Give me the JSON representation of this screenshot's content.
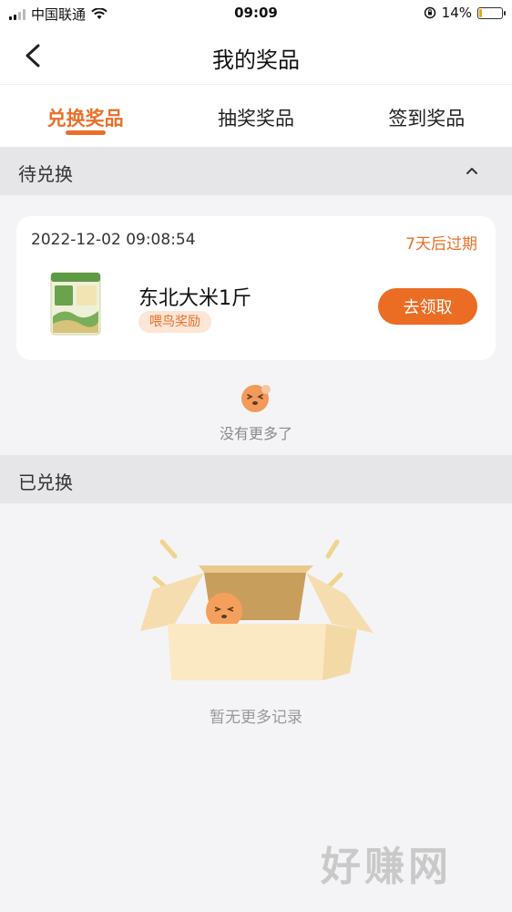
{
  "status_bar": {
    "carrier": "中国联通",
    "time": "09:09",
    "battery": "14%",
    "battery_level": 0.14
  },
  "nav": {
    "title": "我的奖品",
    "back_icon": "chevron-left-icon"
  },
  "tabs": [
    {
      "label": "兑换奖品",
      "active": true
    },
    {
      "label": "抽奖奖品",
      "active": false
    },
    {
      "label": "签到奖品",
      "active": false
    }
  ],
  "pending": {
    "title": "待兑换",
    "items": [
      {
        "date": "2022-12-02 09:08:54",
        "expire": "7天后过期",
        "name": "东北大米1斤",
        "tag": "喂鸟奖励",
        "button": "去领取"
      }
    ],
    "no_more": "没有更多了"
  },
  "redeemed": {
    "title": "已兑换",
    "empty_text": "暂无更多记录"
  },
  "watermark": "好赚网",
  "colors": {
    "accent": "#e8702a",
    "button": "#eb6c23",
    "tag_bg": "#fde6d6"
  }
}
